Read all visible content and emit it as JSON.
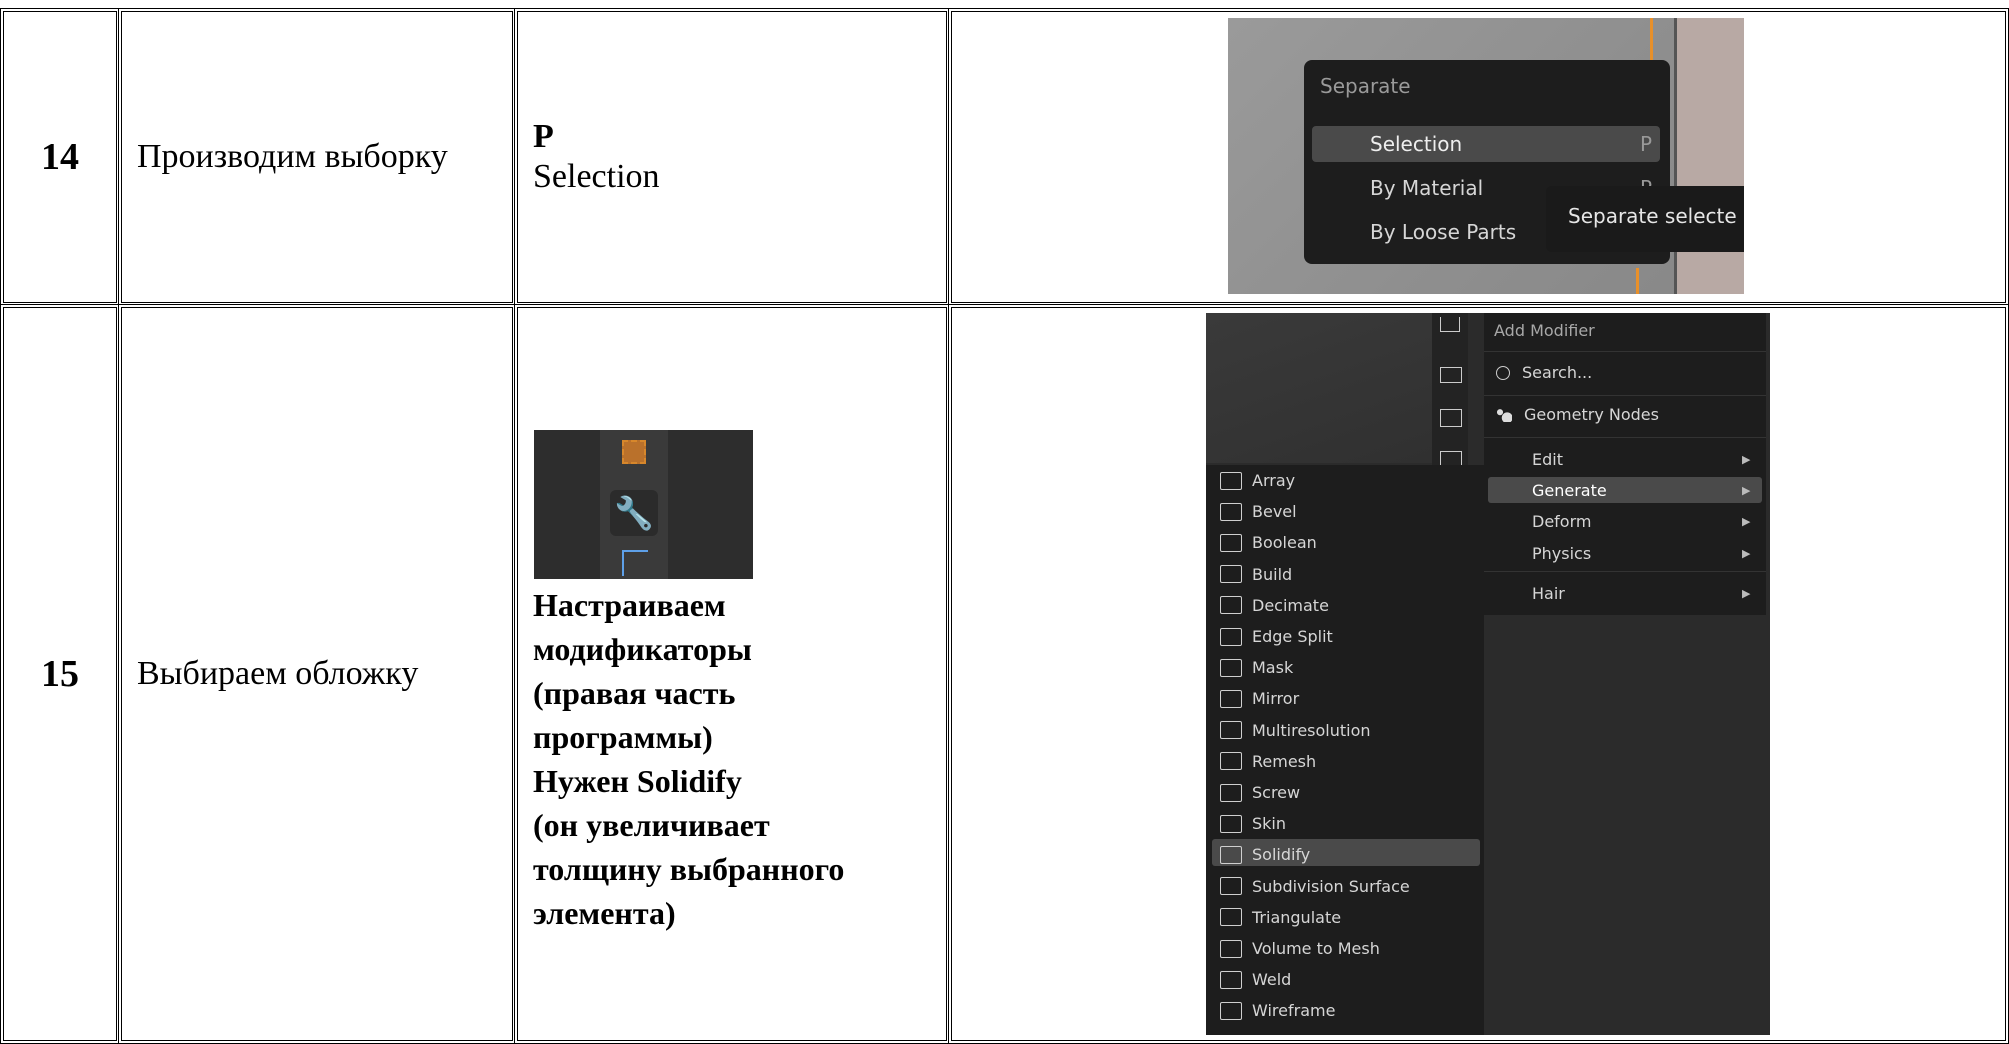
{
  "rows": [
    {
      "num": "14",
      "action": "Производим выборку",
      "hotkey_line1": "P",
      "hotkey_line2": "Selection",
      "screenshot": {
        "menu_title": "Separate",
        "items": [
          {
            "label": "Selection",
            "shortcut": "P"
          },
          {
            "label": "By Material",
            "shortcut": "P"
          },
          {
            "label": "By Loose Parts",
            "shortcut": ""
          }
        ],
        "tooltip": "Separate selecte"
      }
    },
    {
      "num": "15",
      "action": "Выбираем обложку",
      "description_lines": [
        "Настраиваем",
        "модификаторы",
        "(правая часть",
        "программы)",
        "Нужен Solidify",
        "(он увеличивает",
        "толщину выбранного",
        "элемента)"
      ],
      "screenshot": {
        "menu_title": "Add Modifier",
        "search": "Search...",
        "geometry_nodes": "Geometry Nodes",
        "categories": [
          {
            "label": "Edit",
            "active": false
          },
          {
            "label": "Generate",
            "active": true
          },
          {
            "label": "Deform",
            "active": false
          },
          {
            "label": "Physics",
            "active": false
          },
          {
            "label": "Hair",
            "active": false
          }
        ],
        "generate_items": [
          "Array",
          "Bevel",
          "Boolean",
          "Build",
          "Decimate",
          "Edge Split",
          "Mask",
          "Mirror",
          "Multiresolution",
          "Remesh",
          "Screw",
          "Skin",
          "Solidify",
          "Subdivision Surface",
          "Triangulate",
          "Volume to Mesh",
          "Weld",
          "Wireframe"
        ],
        "highlighted_item": "Solidify"
      }
    }
  ],
  "colors": {
    "menu_bg": "#1d1d1d",
    "highlight": "#4a4a4a",
    "accent_orange": "#e8902a",
    "wrench_blue": "#5ea0e8"
  }
}
